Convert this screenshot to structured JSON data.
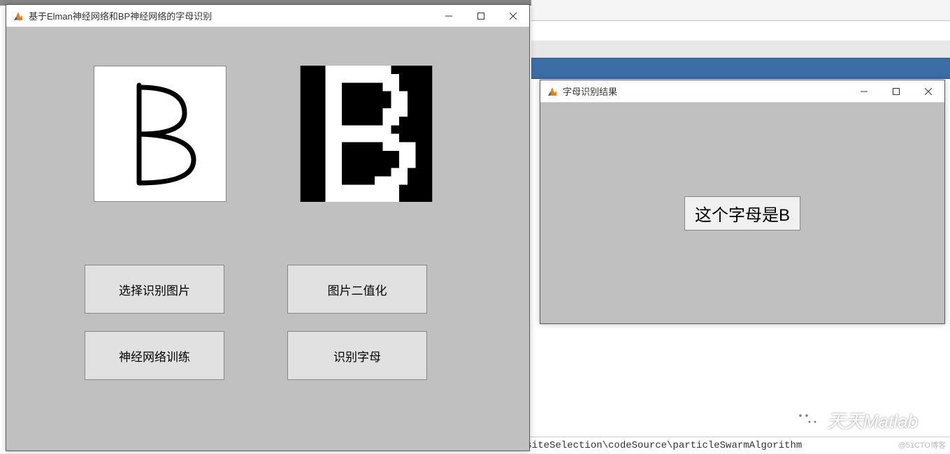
{
  "main_window": {
    "title": "基于Elman神经网络和BP神经网络的字母识别",
    "buttons": {
      "select_image": "选择识别图片",
      "binarize": "图片二值化",
      "train": "神经网络训练",
      "recognize": "识别字母"
    }
  },
  "result_window": {
    "title": "字母识别结果",
    "message": "这个字母是B"
  },
  "background": {
    "path_text": "_siteSelection\\codeSource\\particleSwarmAlgorithm"
  },
  "watermark": {
    "wechat": "天天Matlab",
    "cto": "@51CTO博客"
  }
}
